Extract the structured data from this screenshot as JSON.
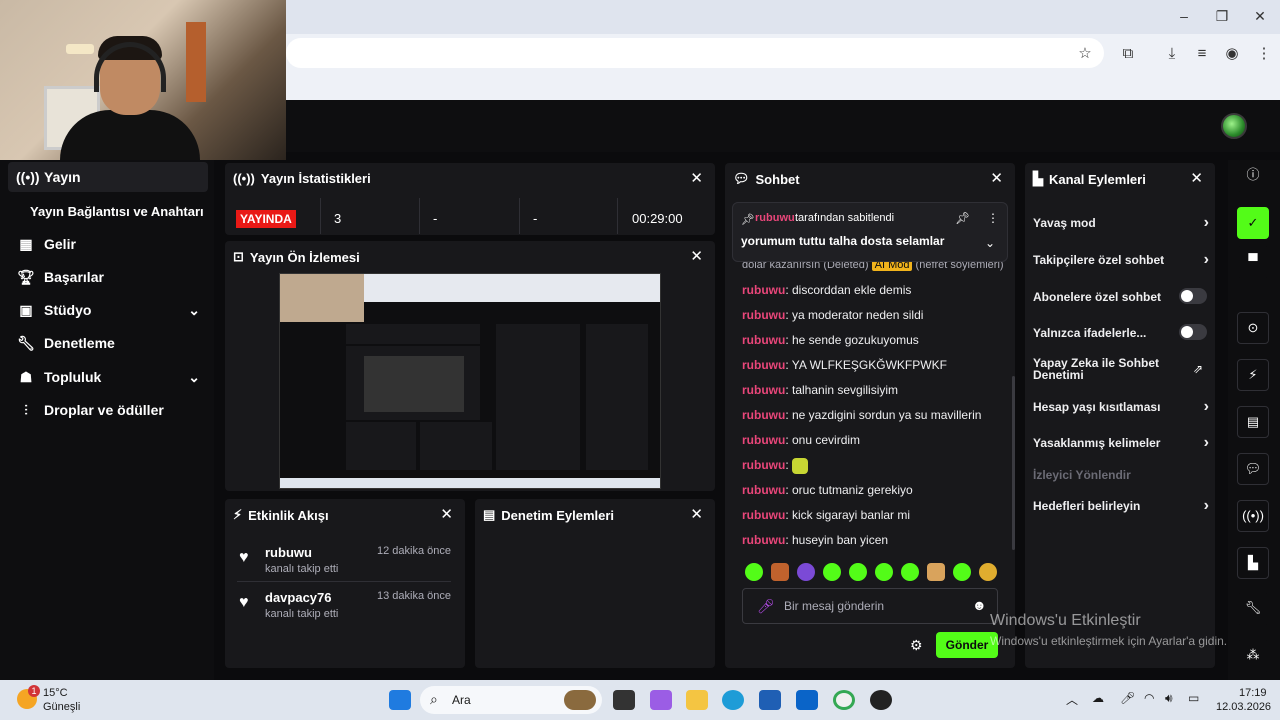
{
  "sidebar": {
    "items": [
      {
        "label": "Yayın",
        "icon": "broadcast-icon"
      },
      {
        "label": "Yayın Bağlantısı ve Anahtarı"
      },
      {
        "label": "Gelir",
        "icon": "revenue-icon"
      },
      {
        "label": "Başarılar",
        "icon": "trophy-icon"
      },
      {
        "label": "Stüdyo",
        "icon": "studio-icon"
      },
      {
        "label": "Denetleme",
        "icon": "wrench-icon"
      },
      {
        "label": "Topluluk",
        "icon": "community-icon"
      },
      {
        "label": "Droplar ve ödüller",
        "icon": "drops-icon"
      }
    ]
  },
  "stats": {
    "title": "Yayın İstatistikleri",
    "live": "YAYINDA",
    "viewers": "3",
    "col3": "-",
    "col4": "-",
    "duration": "00:29:00"
  },
  "preview": {
    "title": "Yayın Ön İzlemesi"
  },
  "activity": {
    "title": "Etkinlik Akışı",
    "events": [
      {
        "user": "rubuwu",
        "action": "kanalı takip etti",
        "time": "12 dakika önce"
      },
      {
        "user": "davpacy76",
        "action": "kanalı takip etti",
        "time": "13 dakika önce"
      }
    ]
  },
  "moderation": {
    "title": "Denetim Eylemleri"
  },
  "chat": {
    "title": "Sohbet",
    "pinned_by_user": "rubuwu",
    "pinned_by_text": "tarafından sabitlendi",
    "pinned_message": "yorumum tuttu talha dosta selamlar",
    "partial_line": "dolar kazanırsın (Deleted)",
    "partial_badge": "AI Mod",
    "partial_tail": "(nefret söylemleri)",
    "messages": [
      {
        "user": "rubuwu",
        "text": ": discorddan ekle demis"
      },
      {
        "user": "rubuwu",
        "text": ": ya moderator neden sildi"
      },
      {
        "user": "rubuwu",
        "text": ": he sende gozukuyomus"
      },
      {
        "user": "rubuwu",
        "text": ": YA WLFKEŞGKĞWKFPWKF"
      },
      {
        "user": "rubuwu",
        "text": ": talhanin sevgilisiyim"
      },
      {
        "user": "rubuwu",
        "text": ": ne yazdigini sordun ya su mavillerin"
      },
      {
        "user": "rubuwu",
        "text": ": onu cevirdim"
      },
      {
        "user": "rubuwu",
        "text": ":"
      },
      {
        "user": "rubuwu",
        "text": ": oruc tutmaniz gerekiyo"
      },
      {
        "user": "rubuwu",
        "text": ": kick sigarayi banlar mi"
      },
      {
        "user": "rubuwu",
        "text": ": huseyin ban yicen"
      }
    ],
    "placeholder": "Bir mesaj gönderin",
    "send": "Gönder"
  },
  "channel_actions": {
    "title": "Kanal Eylemleri",
    "items": [
      {
        "label": "Yavaş mod",
        "control": "chevron"
      },
      {
        "label": "Takipçilere özel sohbet",
        "control": "chevron"
      },
      {
        "label": "Abonelere özel sohbet",
        "control": "toggle"
      },
      {
        "label": "Yalnızca ifadelerle...",
        "control": "toggle"
      },
      {
        "label": "Yapay Zeka ile Sohbet Denetimi",
        "control": "external"
      },
      {
        "label": "Hesap yaşı kısıtlaması",
        "control": "chevron"
      },
      {
        "label": "Yasaklanmış kelimeler",
        "control": "chevron"
      },
      {
        "label": "İzleyici Yönlendir",
        "control": "none"
      },
      {
        "label": "Hedefleri belirleyin",
        "control": "chevron"
      }
    ]
  },
  "watermark": {
    "title": "Windows'u Etkinleştir",
    "subtitle": "Windows'u etkinleştirmek için Ayarlar'a gidin."
  },
  "taskbar": {
    "weather_temp": "15°C",
    "weather_desc": "Güneşli",
    "weather_badge": "1",
    "search": "Ara",
    "time": "17:19",
    "date": "12.03.2026"
  },
  "colors": {
    "accent": "#53fc18",
    "live": "#e91916",
    "username": "#e9467a",
    "panel": "#18181b"
  }
}
